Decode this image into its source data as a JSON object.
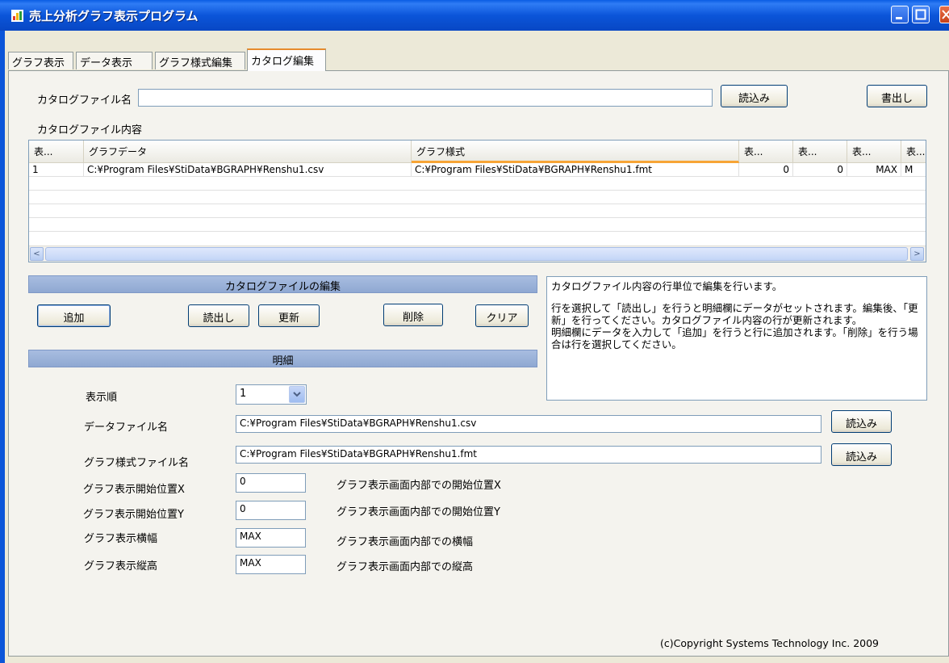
{
  "window": {
    "title": "売上分析グラフ表示プログラム"
  },
  "tabs": [
    "グラフ表示",
    "データ表示",
    "グラフ様式編集",
    "カタログ編集"
  ],
  "catalog_file": {
    "label": "カタログファイル名",
    "value": "",
    "load_button": "読込み",
    "export_button": "書出し"
  },
  "catalog_contents": {
    "label": "カタログファイル内容",
    "columns": [
      "表...",
      "グラフデータ",
      "グラフ様式",
      "表...",
      "表...",
      "表...",
      "表..."
    ],
    "rows": [
      [
        "1",
        "C:¥Program Files¥StiData¥BGRAPH¥Renshu1.csv",
        "C:¥Program Files¥StiData¥BGRAPH¥Renshu1.fmt",
        "0",
        "0",
        "MAX",
        "M"
      ]
    ],
    "scroll_left": "<",
    "scroll_right": ">"
  },
  "edit_section": {
    "title": "カタログファイルの編集",
    "buttons": {
      "add": "追加",
      "read": "読出し",
      "update": "更新",
      "delete": "削除",
      "clear": "クリア"
    }
  },
  "info_text": {
    "line1": "カタログファイル内容の行単位で編集を行います。",
    "line2": "行を選択して「読出し」を行うと明細欄にデータがセットされます。編集後、「更新」を行ってください。カタログファイル内容の行が更新されます。",
    "line3": "明細欄にデータを入力して「追加」を行うと行に追加されます。「削除」を行う場合は行を選択してください。"
  },
  "detail_section": {
    "title": "明細",
    "display_order": {
      "label": "表示順",
      "value": "1"
    },
    "data_file": {
      "label": "データファイル名",
      "value": "C:¥Program Files¥StiData¥BGRAPH¥Renshu1.csv",
      "button": "読込み"
    },
    "style_file": {
      "label": "グラフ様式ファイル名",
      "value": "C:¥Program Files¥StiData¥BGRAPH¥Renshu1.fmt",
      "button": "読込み"
    },
    "start_x": {
      "label": "グラフ表示開始位置X",
      "value": "0",
      "hint": "グラフ表示画面内部での開始位置X"
    },
    "start_y": {
      "label": "グラフ表示開始位置Y",
      "value": "0",
      "hint": "グラフ表示画面内部での開始位置Y"
    },
    "width": {
      "label": "グラフ表示横幅",
      "value": "MAX",
      "hint": "グラフ表示画面内部での横幅"
    },
    "height": {
      "label": "グラフ表示縦高",
      "value": "MAX",
      "hint": "グラフ表示画面内部での縦高"
    }
  },
  "copyright": "(c)Copyright Systems Technology Inc. 2009"
}
